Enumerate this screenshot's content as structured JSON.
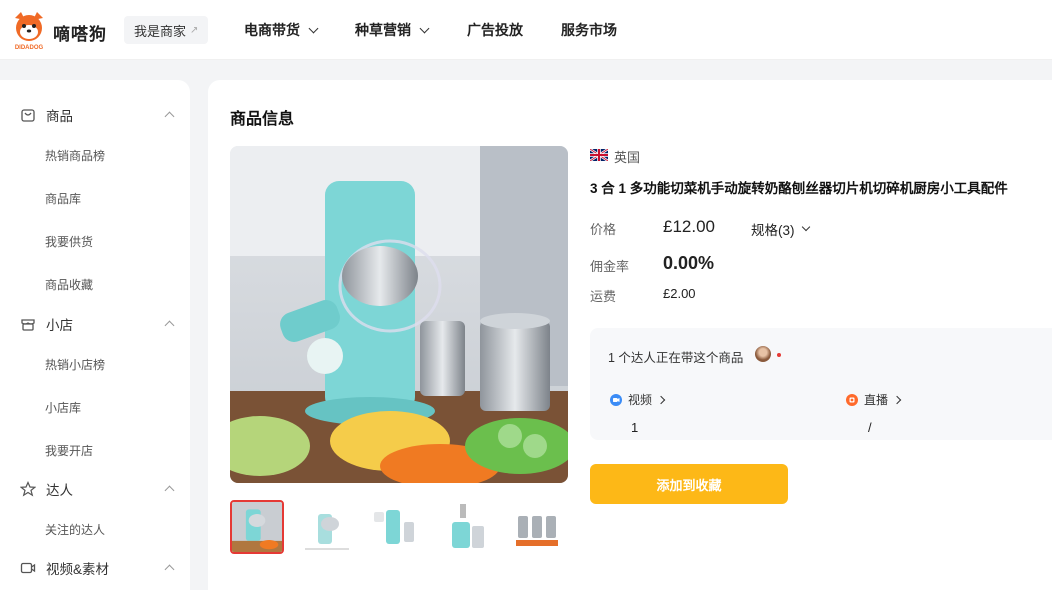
{
  "header": {
    "brand": "嘀嗒狗",
    "logo_text": "DIDADOG",
    "merchant_link": "我是商家",
    "nav": [
      {
        "label": "电商带货",
        "has_dropdown": true
      },
      {
        "label": "种草营销",
        "has_dropdown": true
      },
      {
        "label": "广告投放",
        "has_dropdown": false
      },
      {
        "label": "服务市场",
        "has_dropdown": false
      }
    ]
  },
  "sidebar": {
    "sections": [
      {
        "label": "商品",
        "icon": "bag-icon",
        "items": [
          "热销商品榜",
          "商品库",
          "我要供货",
          "商品收藏"
        ]
      },
      {
        "label": "小店",
        "icon": "shop-icon",
        "items": [
          "热销小店榜",
          "小店库",
          "我要开店"
        ]
      },
      {
        "label": "达人",
        "icon": "star-icon",
        "items": [
          "关注的达人"
        ]
      },
      {
        "label": "视频&素材",
        "icon": "video-icon",
        "items": []
      }
    ]
  },
  "product": {
    "section_title": "商品信息",
    "country": "英国",
    "title": "3 合 1 多功能切菜机手动旋转奶酪刨丝器切片机切碎机厨房小工具配件",
    "price_label": "价格",
    "price": "£12.00",
    "spec_label": "规格(3)",
    "commission_label": "佣金率",
    "commission": "0.00%",
    "shipping_label": "运费",
    "shipping": "£2.00",
    "influencer_text": "1 个达人正在带这个商品",
    "video_label": "视频",
    "video_count": "1",
    "live_label": "直播",
    "live_count": "/",
    "add_button": "添加到收藏"
  },
  "colors": {
    "accent": "#fdb817",
    "brand": "#f06a26",
    "active_thumb": "#e53935"
  }
}
